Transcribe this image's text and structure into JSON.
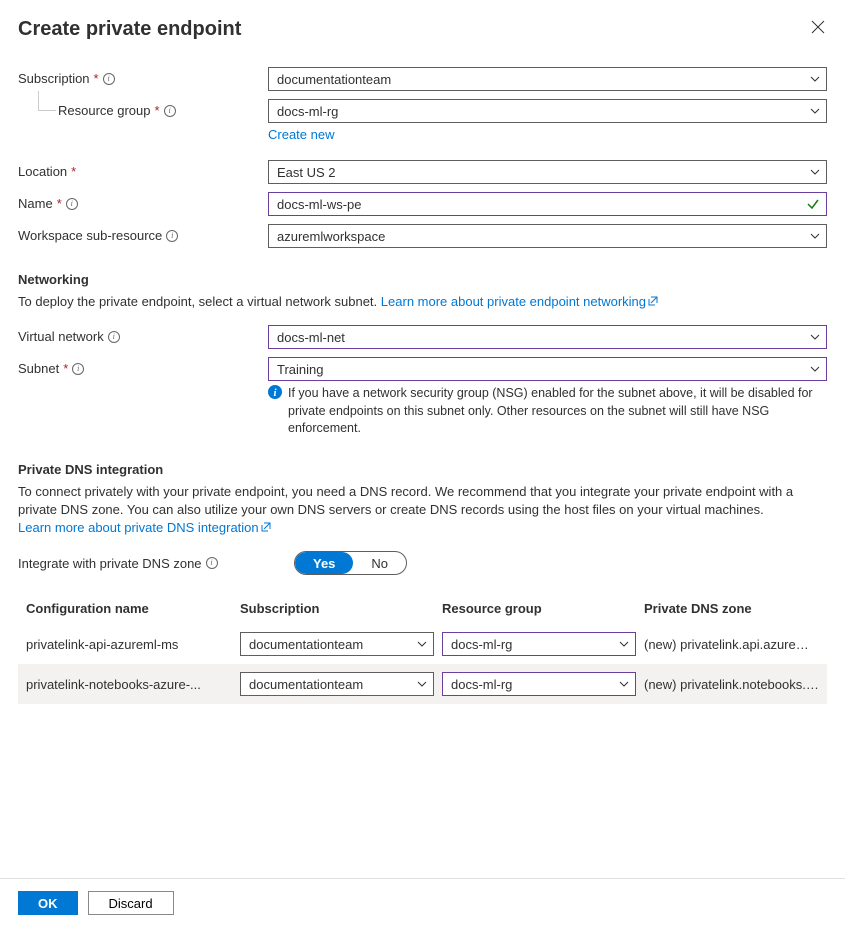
{
  "panel": {
    "title": "Create private endpoint"
  },
  "form": {
    "subscription": {
      "label": "Subscription",
      "value": "documentationteam"
    },
    "resourceGroup": {
      "label": "Resource group",
      "value": "docs-ml-rg",
      "createNew": "Create new"
    },
    "location": {
      "label": "Location",
      "value": "East US 2"
    },
    "name": {
      "label": "Name",
      "value": "docs-ml-ws-pe"
    },
    "workspaceSubResource": {
      "label": "Workspace sub-resource",
      "value": "azuremlworkspace"
    }
  },
  "networking": {
    "heading": "Networking",
    "description": "To deploy the private endpoint, select a virtual network subnet.",
    "learnMore": "Learn more about private endpoint networking",
    "virtualNetwork": {
      "label": "Virtual network",
      "value": "docs-ml-net"
    },
    "subnet": {
      "label": "Subnet",
      "value": "Training"
    },
    "nsgNote": "If you have a network security group (NSG) enabled for the subnet above, it will be disabled for private endpoints on this subnet only. Other resources on the subnet will still have NSG enforcement."
  },
  "dns": {
    "heading": "Private DNS integration",
    "description": "To connect privately with your private endpoint, you need a DNS record. We recommend that you integrate your private endpoint with a private DNS zone. You can also utilize your own DNS servers or create DNS records using the host files on your virtual machines.",
    "learnMore": "Learn more about private DNS integration",
    "integrateLabel": "Integrate with private DNS zone",
    "toggle": {
      "yes": "Yes",
      "no": "No",
      "value": "Yes"
    },
    "columns": {
      "config": "Configuration name",
      "subscription": "Subscription",
      "resourceGroup": "Resource group",
      "zone": "Private DNS zone"
    },
    "rows": [
      {
        "config": "privatelink-api-azureml-ms",
        "subscription": "documentationteam",
        "resourceGroup": "docs-ml-rg",
        "zone": "(new) privatelink.api.azureml...."
      },
      {
        "config": "privatelink-notebooks-azure-...",
        "subscription": "documentationteam",
        "resourceGroup": "docs-ml-rg",
        "zone": "(new) privatelink.notebooks.a..."
      }
    ]
  },
  "footer": {
    "ok": "OK",
    "discard": "Discard"
  }
}
